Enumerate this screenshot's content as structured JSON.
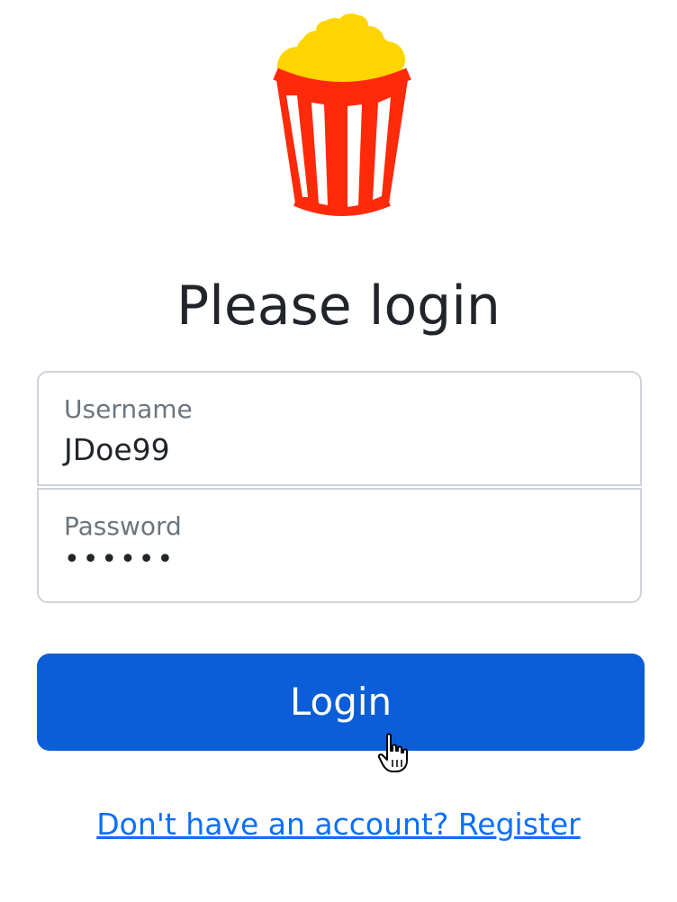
{
  "logo": {
    "icon": "popcorn-icon",
    "colors": {
      "bucket": "#ff2a0a",
      "popcorn": "#ffd400",
      "stripe": "#ffffff"
    }
  },
  "heading": "Please login",
  "form": {
    "username": {
      "label": "Username",
      "value": "JDoe99"
    },
    "password": {
      "label": "Password",
      "value": "••••••"
    }
  },
  "actions": {
    "login_label": "Login",
    "register_link": "Don't have an account? Register"
  },
  "colors": {
    "primary": "#0b5ed7",
    "link": "#0d6efd",
    "text": "#212529",
    "muted": "#6c757d",
    "border": "#ced4da"
  }
}
